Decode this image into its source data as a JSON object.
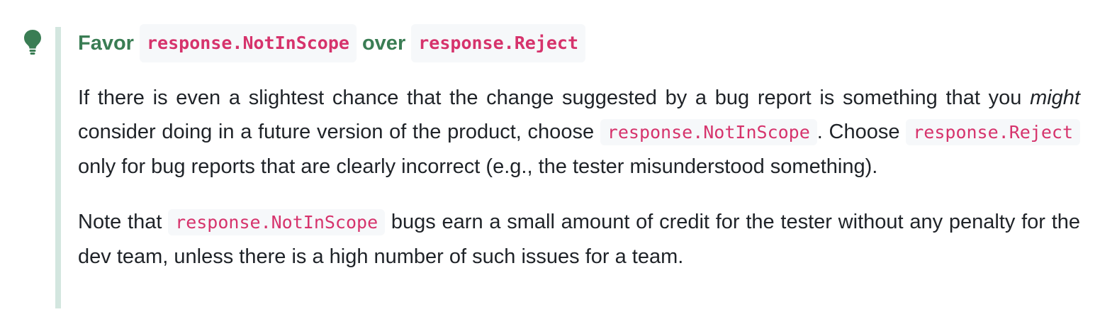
{
  "callout": {
    "icon": "lightbulb-icon",
    "accent_color": "#3a7d54",
    "bar_color": "#d3e6df",
    "code_color": "#d6336c",
    "title": {
      "prefix": "Favor",
      "code1": "response.NotInScope",
      "middle": "over",
      "code2": "response.Reject"
    },
    "paragraph1": {
      "t1": "If there is even a slightest chance that the change suggested by a bug report is something that you",
      "emphasis": "might",
      "t2": "consider doing in a future version of the product, choose",
      "code1": "response.NotInScope",
      "t3": ". Choose",
      "code2": "response.Reject",
      "t4": "only for bug reports that are clearly incorrect (e.g., the tester misunderstood something)."
    },
    "paragraph2": {
      "t1": "Note that",
      "code": "response.NotInScope",
      "t2": "bugs earn a small amount of credit for the tester without any penalty for the dev team, unless there is a high number of such issues for a team."
    }
  }
}
